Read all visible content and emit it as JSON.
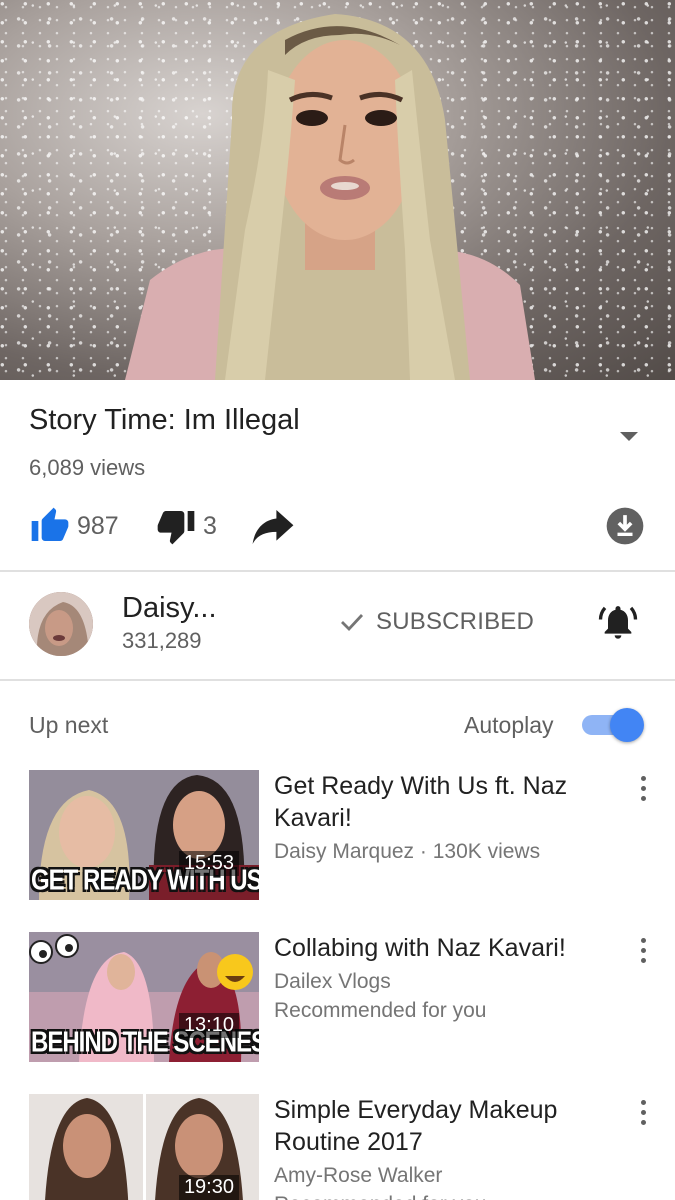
{
  "video": {
    "title": "Story Time: Im Illegal",
    "views": "6,089 views",
    "likes": "987",
    "dislikes": "3"
  },
  "channel": {
    "name": "Daisy...",
    "subscribers": "331,289",
    "subscribe_label": "SUBSCRIBED"
  },
  "up_next": {
    "label": "Up next",
    "autoplay_label": "Autoplay",
    "autoplay_on": true
  },
  "icons": {
    "like": "thumbs-up-icon",
    "dislike": "thumbs-down-icon",
    "share": "share-icon",
    "download": "download-icon",
    "check": "check-icon",
    "bell": "notification-bell-icon",
    "expand": "expand-arrow-icon",
    "more": "more-vert-icon"
  },
  "colors": {
    "accent": "#1a73e8",
    "toggle_knob": "#4285f4",
    "toggle_track": "#8fb4f5",
    "secondary_text": "#606060"
  },
  "videos": [
    {
      "title": "Get Ready With Us ft. Naz Kavari!",
      "meta1": "Daisy Marquez · 130K views",
      "meta2": "",
      "duration": "15:53",
      "thumb_text": "GET READY WITH US!"
    },
    {
      "title": "Collabing with Naz Kavari!",
      "meta1": "Dailex Vlogs",
      "meta2": "Recommended for you",
      "duration": "13:10",
      "thumb_text": "BEHIND THE SCENES"
    },
    {
      "title": "Simple Everyday Makeup Routine 2017",
      "meta1": "Amy-Rose Walker",
      "meta2": "Recommended for you",
      "duration": "19:30",
      "thumb_text": ""
    }
  ]
}
